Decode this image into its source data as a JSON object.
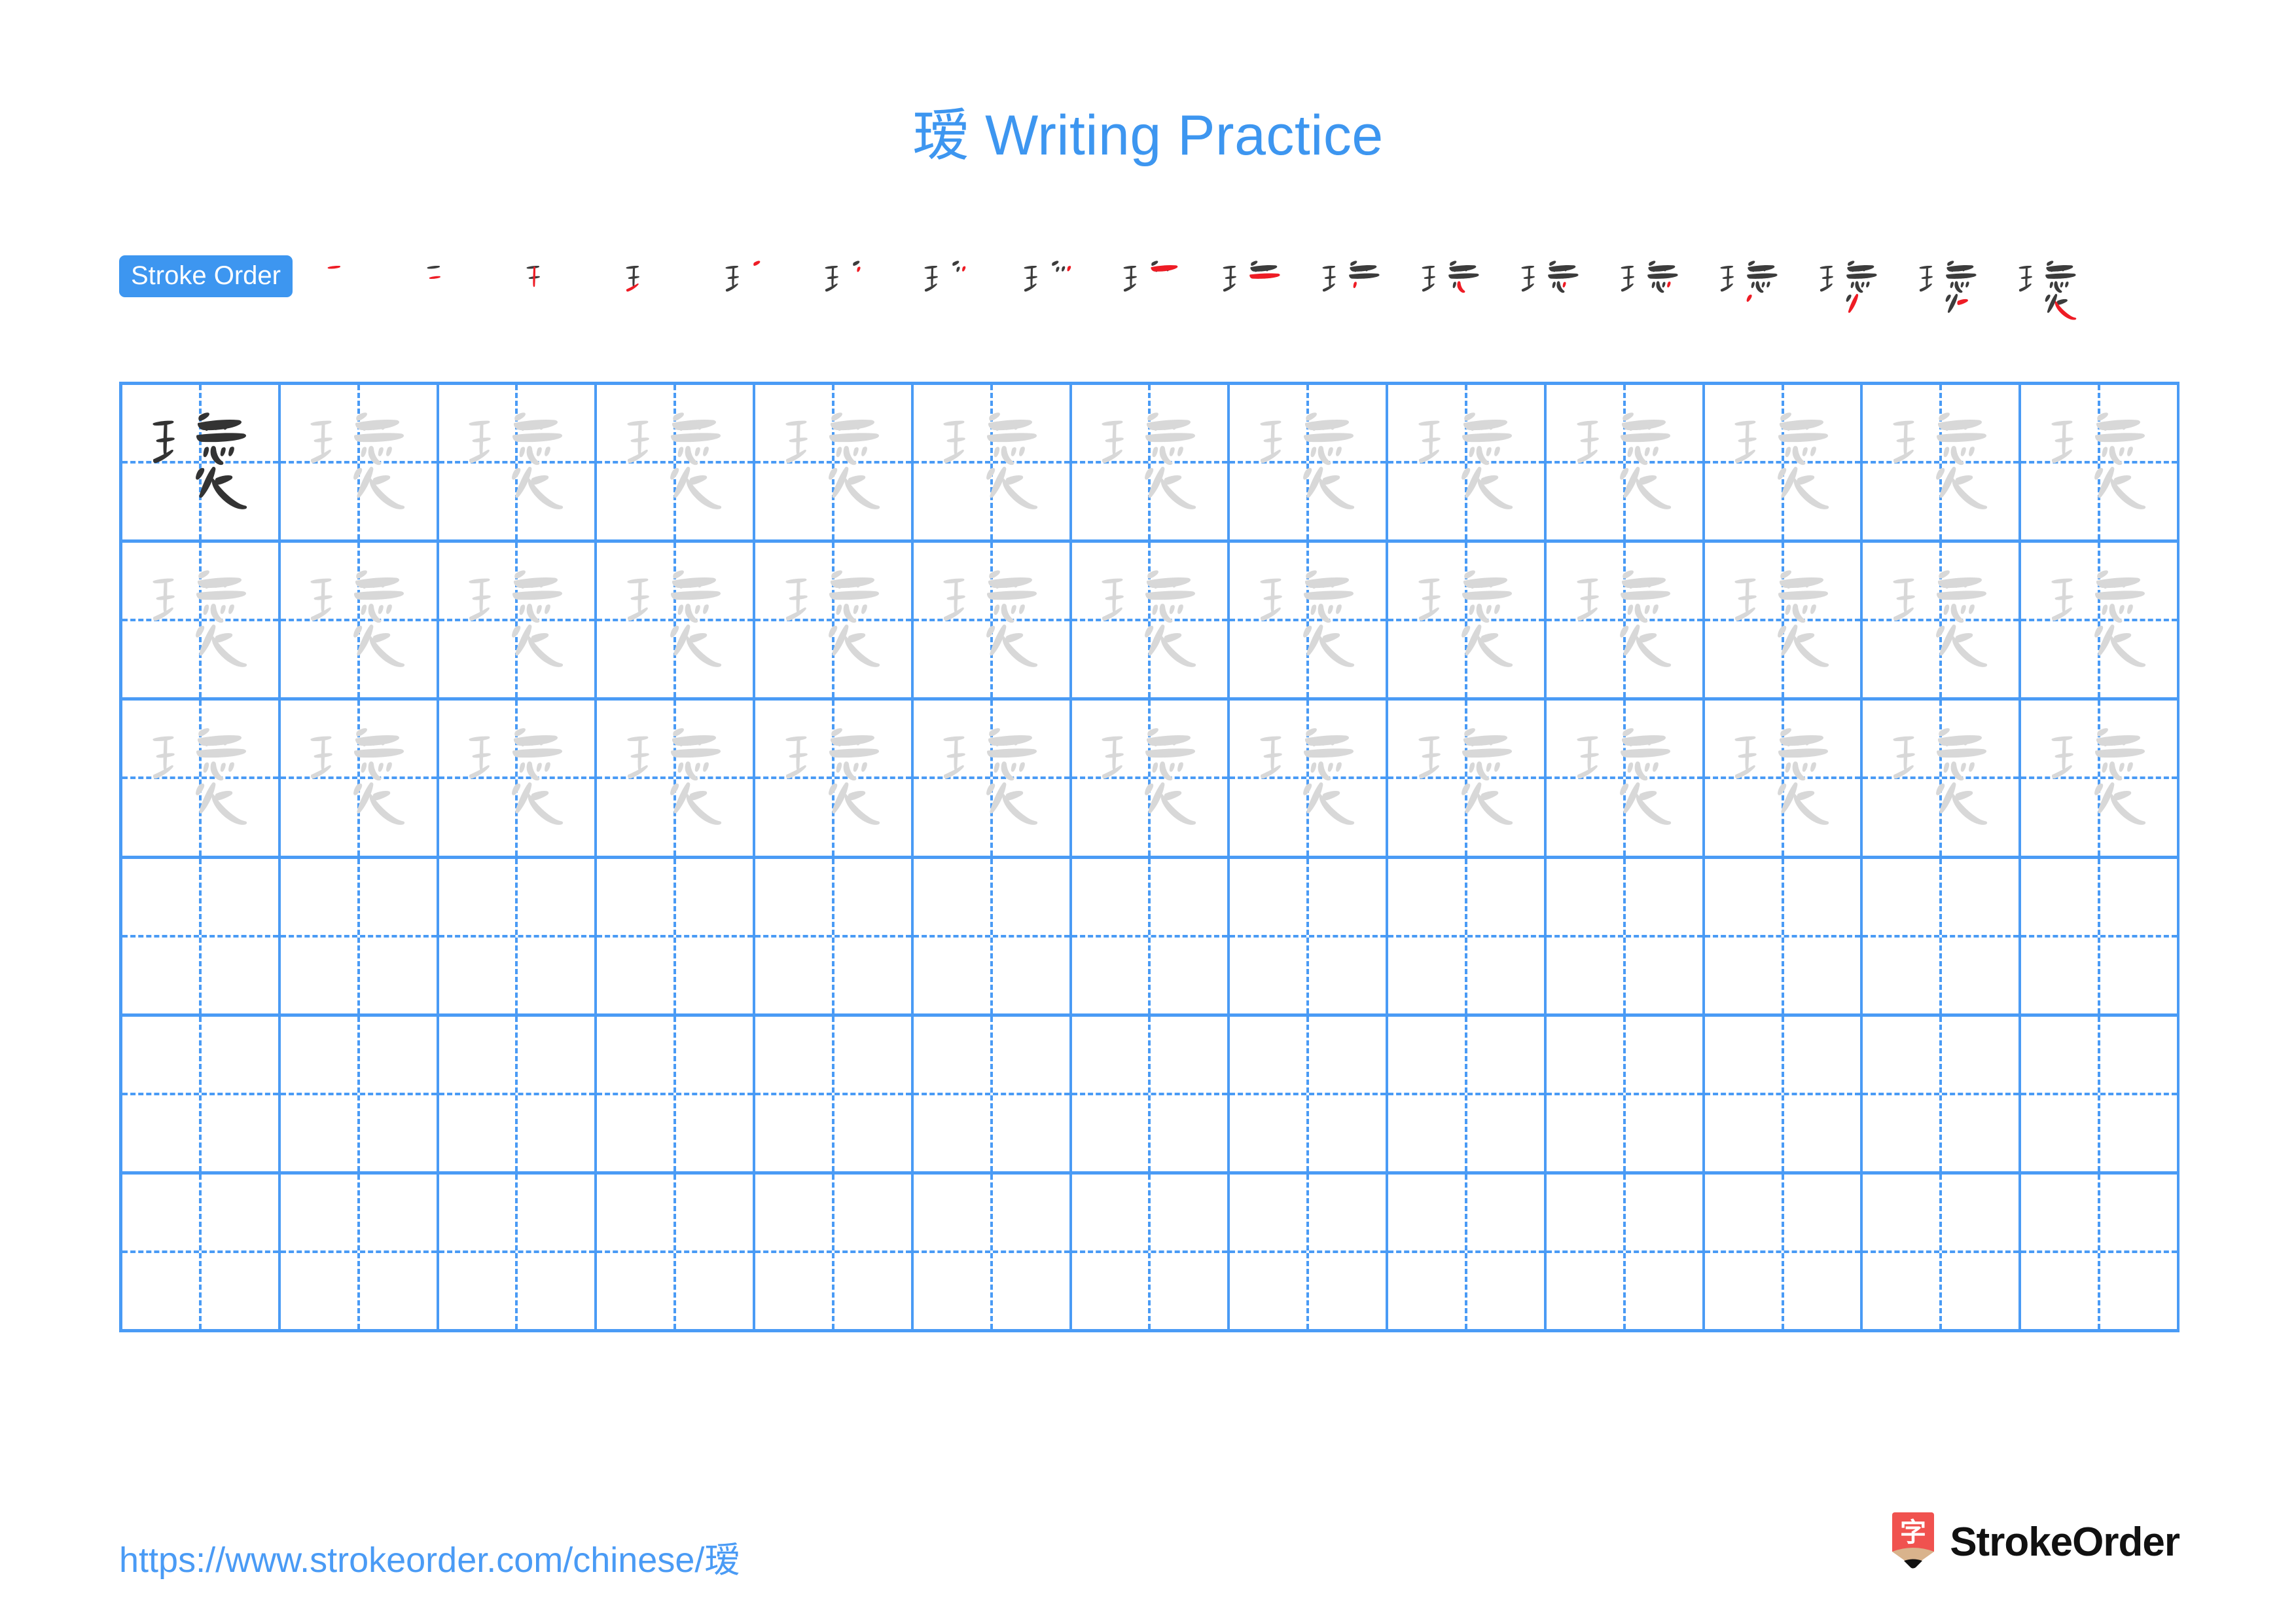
{
  "character": "瑷",
  "title": {
    "character": "瑷",
    "suffix": " Writing Practice",
    "full": "瑷 Writing Practice",
    "color": "#3d96f0"
  },
  "stroke_order": {
    "badge_label": "Stroke Order",
    "badge_bg": "#3d96f0",
    "badge_text_color": "#ffffff",
    "total_strokes": 18,
    "new_stroke_color": "#ee1c25",
    "existing_stroke_color": "#3c3c3c",
    "steps": [
      1,
      2,
      3,
      4,
      5,
      6,
      7,
      8,
      9,
      10,
      11,
      12,
      13,
      14,
      15,
      16,
      17,
      18
    ]
  },
  "grid": {
    "columns": 13,
    "rows": 6,
    "line_color": "#4a9bf5",
    "guide_style": "dashed",
    "dark_glyph_color": "#333333",
    "ghost_glyph_color": "#d8d8d8",
    "row_fill": [
      {
        "dark_cells": 1,
        "ghost_cells": 12
      },
      {
        "dark_cells": 0,
        "ghost_cells": 13
      },
      {
        "dark_cells": 0,
        "ghost_cells": 13
      },
      {
        "dark_cells": 0,
        "ghost_cells": 0
      },
      {
        "dark_cells": 0,
        "ghost_cells": 0
      },
      {
        "dark_cells": 0,
        "ghost_cells": 0
      }
    ]
  },
  "footer": {
    "url": "https://www.strokeorder.com/chinese/瑷",
    "url_color": "#4a9bf5",
    "brand_name": "StrokeOrder",
    "logo_char": "字",
    "logo_badge_color": "#f0524f",
    "logo_body_color": "#d9b38c",
    "logo_tip_color": "#111111"
  }
}
